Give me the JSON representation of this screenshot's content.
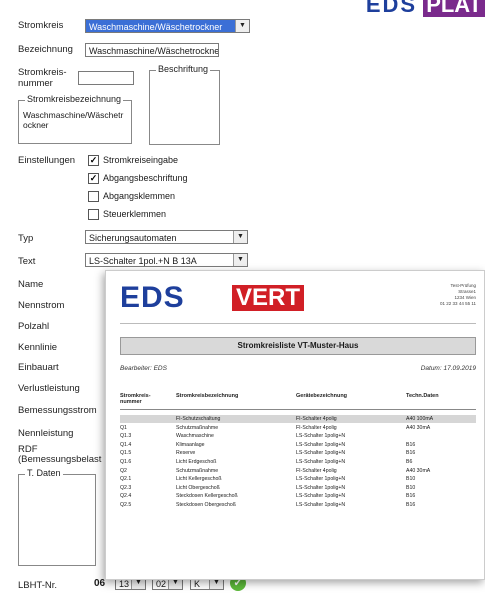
{
  "brand": {
    "eds": "EDS",
    "plat": "PLAT",
    "eds_color": "#1e3f9c",
    "plat_color": "#7a2a8c"
  },
  "form": {
    "stromkreis_label": "Stromkreis",
    "stromkreis_value": "Waschmaschine/Wäschetrockner",
    "bezeichnung_label": "Bezeichnung",
    "bezeichnung_value": "Waschmaschine/Wäschetrockner",
    "stromkreisnummer_label": "Stromkreis-\nnummer",
    "stromkreisnummer_value": "",
    "beschriftung_title": "Beschriftung",
    "stromkreisbezeichnung_title": "Stromkreisbezeichnung",
    "stromkreisbezeichnung_text": "Waschmaschine/Wäschetr\nockner",
    "einstellungen_label": "Einstellungen",
    "checkboxes": [
      {
        "label": "Stromkreiseingabe",
        "checked": true
      },
      {
        "label": "Abgangsbeschriftung",
        "checked": true
      },
      {
        "label": "Abgangsklemmen",
        "checked": false
      },
      {
        "label": "Steuerklemmen",
        "checked": false
      }
    ],
    "typ_label": "Typ",
    "typ_value": "Sicherungsautomaten",
    "text_label": "Text",
    "text_value": "LS-Schalter 1pol.+N B 13A",
    "name_label": "Name",
    "nennstrom_label": "Nennstrom",
    "polzahl_label": "Polzahl",
    "kennlinie_label": "Kennlinie",
    "einbauart_label": "Einbauart",
    "verlustleistung_label": "Verlustleistung",
    "bemessungsstrom_label": "Bemessungsstrom",
    "nennleistung_label": "Nennleistung",
    "rdf_label": "RDF\n(Bemessungsbelast",
    "tdaten_title": "T. Daten",
    "lbht_label": "LBHT-Nr.",
    "lbht_prefix": "06",
    "lbht_sel1": "13",
    "lbht_sel2": "02",
    "lbht_sel3": "K"
  },
  "report": {
    "logo_eds": "EDS",
    "logo_vert": "VERT",
    "address": "Test-Prüfung\nStrasse1\n1234 Wien\n01 22 33 44 55 11",
    "title": "Stromkreisliste VT-Muster-Haus",
    "bearbeiter": "Bearbeiter: EDS",
    "datum": "Datum: 17.09.2019",
    "headers": [
      "Stromkreis-\nnummer",
      "Stromkreisbezeichnung",
      "Gerätebezeichnung",
      "Techn.Daten"
    ],
    "rows": [
      [
        "",
        "FI-Schutzschaltung",
        "FI-Schalter 4polig",
        "A40 100mA"
      ],
      [
        "Q1",
        "Schutzmaßnahme",
        "FI-Schalter 4polig",
        "A40 30mA"
      ],
      [
        "Q1.3",
        "Waschmaschine",
        "LS-Schalter 1polig+N",
        ""
      ],
      [
        "Q1.4",
        "Klimaanlage",
        "LS-Schalter 1polig+N",
        "B16"
      ],
      [
        "Q1.5",
        "Reserve",
        "LS-Schalter 1polig+N",
        "B16"
      ],
      [
        "Q1.6",
        "Licht Erdgeschoß",
        "LS-Schalter 1polig+N",
        "B6"
      ],
      [
        "Q2",
        "Schutzmaßnahme",
        "FI-Schalter 4polig",
        "A40 30mA"
      ],
      [
        "Q2.1",
        "Licht Kellergeschoß",
        "LS-Schalter 1polig+N",
        "B10"
      ],
      [
        "Q2.3",
        "Licht Obergeschoß",
        "LS-Schalter 1polig+N",
        "B10"
      ],
      [
        "Q2.4",
        "Steckdosen Kellergeschoß",
        "LS-Schalter 1polig+N",
        "B16"
      ],
      [
        "Q2.5",
        "Steckdosen Obergeschoß",
        "LS-Schalter 1polig+N",
        "B16"
      ]
    ]
  }
}
